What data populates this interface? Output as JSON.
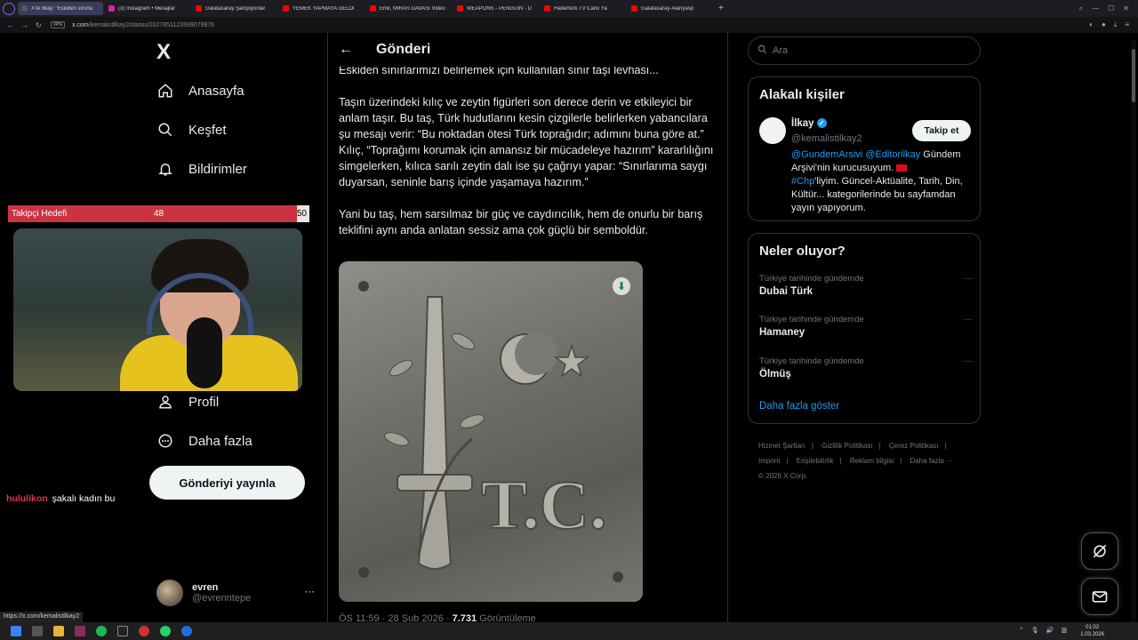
{
  "browser": {
    "tabs": [
      {
        "label": "X'te İlkay: \"Eskiden sınırla",
        "color": "#555",
        "active": true
      },
      {
        "label": "(3) Instagram • Mesajlar",
        "color": "#d6249f",
        "active": false
      },
      {
        "label": "Galatasaray Şampiyonlar",
        "color": "#ff0000",
        "active": false
      },
      {
        "label": "YEMEK YAPMAYA GELDİ",
        "color": "#ff0000",
        "active": false
      },
      {
        "label": "Erlik, MİRAS DAVASI Video",
        "color": "#ff0000",
        "active": false
      },
      {
        "label": "WEAPONS - PENGUIN - D",
        "color": "#ff0000",
        "active": false
      },
      {
        "label": "Habertürk TV Canlı Ya",
        "color": "#ff0000",
        "active": false
      },
      {
        "label": "Galatasaray-Alanyasp",
        "color": "#ff0000",
        "active": false
      }
    ],
    "new_tab": "+",
    "vpn": "VPN",
    "url_domain": "x.com",
    "url_path": "/kemalistilkay2/status/2027851122699079976",
    "status_url": "https://x.com/kemalistilkay2"
  },
  "nav": {
    "logo": "X",
    "items": [
      {
        "label": "Anasayfa",
        "icon": "home-icon"
      },
      {
        "label": "Keşfet",
        "icon": "search-icon"
      },
      {
        "label": "Bildirimler",
        "icon": "bell-icon"
      },
      {
        "label": "Profil",
        "icon": "person-icon"
      },
      {
        "label": "Daha fazla",
        "icon": "more-circle-icon"
      }
    ],
    "post_button": "Gönderiyi yayınla",
    "account": {
      "name": "evren",
      "handle": "@evrenntepe"
    }
  },
  "post": {
    "header_title": "Gönderi",
    "paragraphs": [
      "Eskiden sınırlarımızı belirlemek için kullanılan sınır taşı levhası...",
      "",
      "Taşın üzerindeki kılıç ve zeytin figürleri son derece derin ve etkileyici bir anlam taşır. Bu taş, Türk hudutlarını kesin çizgilerle belirlerken yabancılara şu mesajı verir: “Bu noktadan ötesi Türk toprağıdır; adımını buna göre at.”",
      "Kılıç, “Toprağımı korumak için amansız bir mücadeleye hazırım” kararlılığını simgelerken, kılıca sarılı zeytin dalı ise şu çağrıyı yapar: “Sınırlarıma saygı duyarsan, seninle barış içinde yaşamaya hazırım.”",
      "",
      "Yani bu taş, hem sarsılmaz bir güç ve caydırıcılık, hem de onurlu bir barış teklifini aynı anda anlatan sessiz ama çok güçlü bir semboldür."
    ],
    "image_text": "T.C.",
    "meta_time": "ÖS 11:59 · 28 Şub 2026 · ",
    "meta_views": "7.731",
    "meta_views_label": " Görüntüleme"
  },
  "sidebar": {
    "search_placeholder": "Ara",
    "related_title": "Alakalı kişiler",
    "related_user": {
      "name": "İlkay",
      "handle": "@kemalistilkay2",
      "follow_label": "Takip et",
      "bio_link1": "@GundemArsivi",
      "bio_link2": "@Editorilkay",
      "bio_text1": " Gündem Arşivi'nin kurucusuyum. ",
      "bio_hashtag": "#Chp",
      "bio_text2": "'liyim. Güncel-Aktüalite, Tarih, Din, Kültür... kategorilerinde bu sayfamdan yayın yapıyorum."
    },
    "trends_title": "Neler oluyor?",
    "trends": [
      {
        "context": "Türkiye tarihinde gündemde",
        "name": "Dubai Türk"
      },
      {
        "context": "Türkiye tarihinde gündemde",
        "name": "Hamaney"
      },
      {
        "context": "Türkiye tarihinde gündemde",
        "name": "Ölmüş"
      }
    ],
    "show_more": "Daha fazla göster",
    "footer_links": [
      "Hizmet Şartları",
      "Gizlilik Politikası",
      "Çerez Politikası",
      "Imprint",
      "Erişilebilirlik",
      "Reklam bilgisi",
      "Daha fazla ···"
    ],
    "copyright": "© 2026 X Corp."
  },
  "overlay": {
    "goal_label": "Takipçi Hedefi",
    "goal_current": "48",
    "goal_max": "50",
    "goal_fraction": 0.96,
    "chat_user": "hululikon",
    "chat_message": "şakalı kadın bu"
  },
  "taskbar": {
    "time": "01:02",
    "date": "1.03.2026"
  },
  "colors": {
    "accent": "#1d9bf0",
    "goal_fill": "#cc3340"
  }
}
